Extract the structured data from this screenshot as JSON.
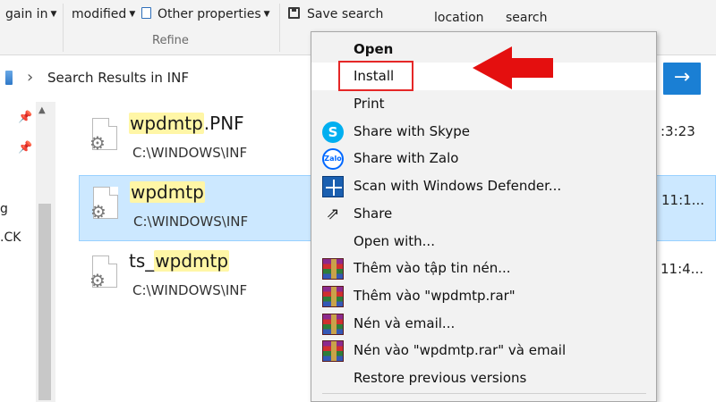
{
  "ribbon": {
    "sort_fragment": "gain in",
    "date_modified": "modified",
    "other_properties": "Other properties",
    "save_search": "Save search",
    "open_location": "location",
    "close_search": "search",
    "group_refine": "Refine"
  },
  "address": {
    "path": "Search Results in INF",
    "go_icon": "arrow-right-icon"
  },
  "nav_fragments": [
    "g",
    ".CK"
  ],
  "files": [
    {
      "name_highlight": "wpdmtp",
      "name_suffix": ".PNF",
      "name_prefix": "",
      "path": "C:\\WINDOWS\\INF",
      "time": ":3:23"
    },
    {
      "name_highlight": "wpdmtp",
      "name_suffix": "",
      "name_prefix": "",
      "path": "C:\\WINDOWS\\INF",
      "time": "11:1..."
    },
    {
      "name_highlight": "wpdmtp",
      "name_suffix": "",
      "name_prefix": "ts_",
      "path": "C:\\WINDOWS\\INF",
      "time": "11:4..."
    }
  ],
  "context_menu": {
    "items": [
      {
        "label": "Open",
        "icon": ""
      },
      {
        "label": "Install",
        "icon": ""
      },
      {
        "label": "Print",
        "icon": ""
      },
      {
        "label": "Share with Skype",
        "icon": "skype-icon"
      },
      {
        "label": "Share with Zalo",
        "icon": "zalo-icon"
      },
      {
        "label": "Scan with Windows Defender...",
        "icon": "windows-defender-icon"
      },
      {
        "label": "Share",
        "icon": "share-icon"
      },
      {
        "label": "Open with...",
        "icon": ""
      },
      {
        "label": "Thêm vào tập tin nén...",
        "icon": "winrar-icon"
      },
      {
        "label": "Thêm vào \"wpdmtp.rar\"",
        "icon": "winrar-icon"
      },
      {
        "label": "Nén và email...",
        "icon": "winrar-icon"
      },
      {
        "label": "Nén vào \"wpdmtp.rar\" và email",
        "icon": "winrar-icon"
      },
      {
        "label": "Restore previous versions",
        "icon": ""
      }
    ]
  },
  "icon_text": {
    "skype": "S",
    "zalo": "Zalo"
  },
  "colors": {
    "selection": "#cce8ff",
    "highlight": "#fff6a6",
    "accent": "#1a7fd4",
    "annotation_red": "#e40f0f"
  }
}
